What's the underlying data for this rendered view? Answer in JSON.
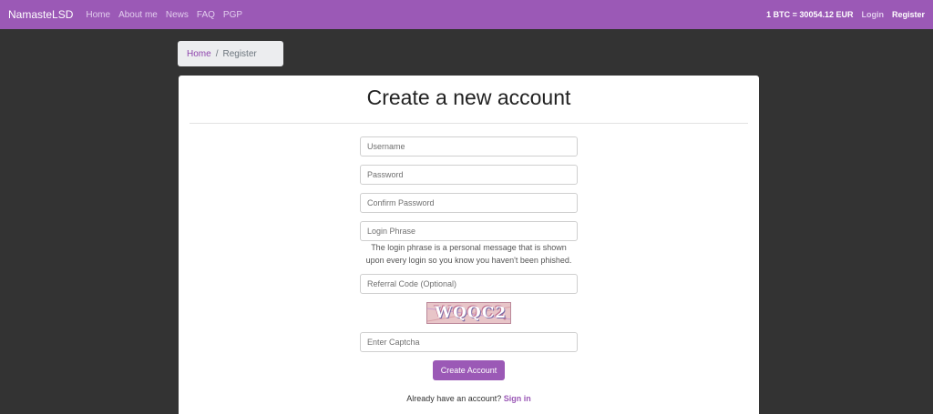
{
  "navbar": {
    "brand": "NamasteLSD",
    "links": [
      "Home",
      "About me",
      "News",
      "FAQ",
      "PGP"
    ],
    "btc_rate": "1 BTC = 30054.12 EUR",
    "login": "Login",
    "register": "Register",
    "color": "#9b59b6"
  },
  "breadcrumb": {
    "home": "Home",
    "separator": "/",
    "current": "Register"
  },
  "form": {
    "title": "Create a new account",
    "username_placeholder": "Username",
    "password_placeholder": "Password",
    "confirm_placeholder": "Confirm Password",
    "phrase_placeholder": "Login Phrase",
    "phrase_help_line1": "The login phrase is a personal message that is shown",
    "phrase_help_line2": "upon every login so you know you haven't been phished.",
    "referral_placeholder": "Referral Code (Optional)",
    "captcha_text": "WQQC2",
    "captcha_placeholder": "Enter Captcha",
    "submit_label": "Create Account",
    "signin_prompt": "Already have an account?",
    "signin_link": "Sign in"
  }
}
